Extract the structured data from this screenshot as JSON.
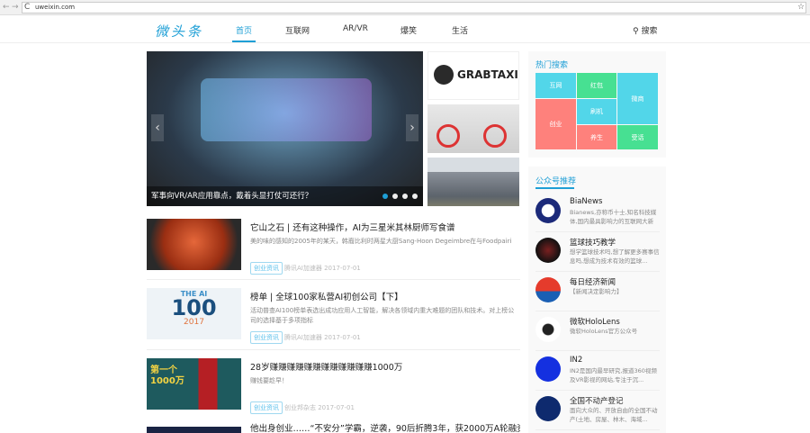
{
  "browser": {
    "url": "uweixin.com",
    "back": "←",
    "forward": "→",
    "reload": "C",
    "star": "☆"
  },
  "header": {
    "logo": "微头条",
    "nav": [
      "首页",
      "互联网",
      "AR/VR",
      "爆笑",
      "生活"
    ],
    "search": "搜索"
  },
  "carousel": {
    "caption": "军事向VR/AR应用靠点，戴着头显打仗可还行？",
    "slides": 4,
    "active": 0
  },
  "thumbs": {
    "grab": "GRABTAXI"
  },
  "articles": [
    {
      "title": "它山之石 | 还有这种操作，AI为三星米其林厨师写食谱",
      "desc": "美的味的感知的2005年的某天，韩裔比利时两星大厨Sang-Hoon Degeimbre在与Foodpairi",
      "tag": "创业资讯",
      "meta": "腾讯AI加速器 2017-07-01"
    },
    {
      "title": "榜单 | 全球100家私营AI初创公司【下】",
      "desc": "活动普查AI100榜单表选出成功应用人工智能，解决各领域内重大难题的团队和技术。对上榜公司的选择基于多项指标",
      "tag": "创业资讯",
      "meta": "腾讯AI加速器 2017-07-01",
      "img_text": "THE AI",
      "img_num": "100",
      "img_year": "2017"
    },
    {
      "title": "28岁赚赚赚赚赚赚赚赚赚赚赚赚1000万",
      "desc": "赚钱要趁早！",
      "tag": "创业资讯",
      "meta": "创业邦杂志 2017-07-01",
      "img_text": "第一个1000万"
    },
    {
      "title": "他出身创业……“不安分”学霸，逆袭，90后折腾3年，获2000万A轮融资"
    }
  ],
  "hot": {
    "title": "热门搜索",
    "cells": [
      "互网",
      "创业",
      "红包",
      "刷机",
      "养生",
      "微商",
      "受话"
    ]
  },
  "accounts": {
    "title": "公众号推荐",
    "items": [
      {
        "name": "BiaNews",
        "desc": "Bianews,亦称币十士,知名科技媒体,国内最具影响力的互联网大新闻..."
      },
      {
        "name": "篮球技巧教学",
        "desc": "想学篮球技术吗,想了解更多赛事信息吗,想成为技术有效的篮球..."
      },
      {
        "name": "每日经济新闻",
        "desc": "【新闻决定影响力】"
      },
      {
        "name": "微软HoloLens",
        "desc": "微软HoloLens官方公众号"
      },
      {
        "name": "IN2",
        "desc": "IN2是国内最早研究,报道360视频及VR影视的网站,专注于沉..."
      },
      {
        "name": "全国不动产登记",
        "desc": "面向大众的、开放自由的全国不动产(土地、房屋、林木、海域..."
      }
    ]
  },
  "colors": {
    "accent": "#1e9fd6",
    "blue": "#52d6e9",
    "green": "#47e092",
    "red": "#fe817c"
  }
}
